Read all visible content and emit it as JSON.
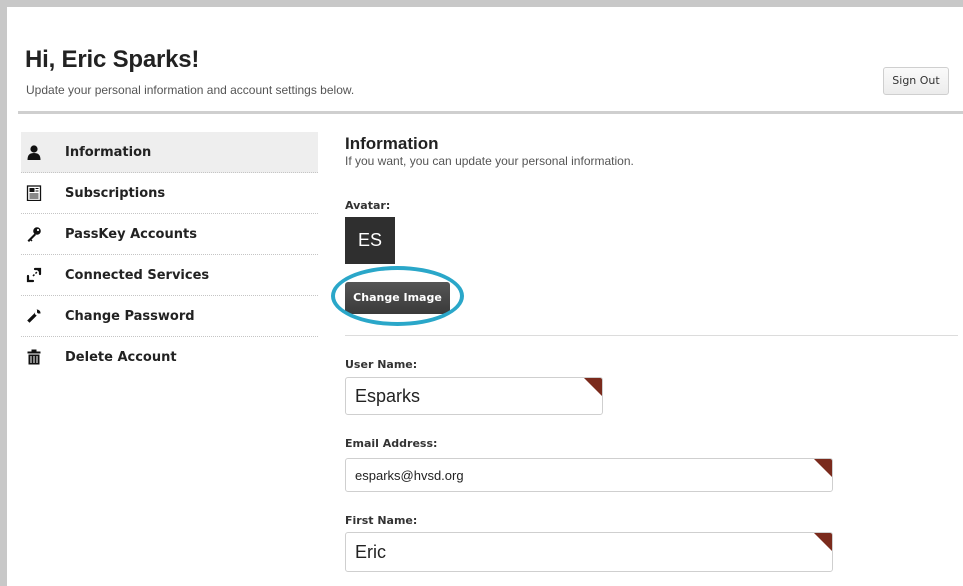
{
  "header": {
    "greeting": "Hi, Eric Sparks!",
    "subtitle": "Update your personal information and account settings below.",
    "signout_label": "Sign Out"
  },
  "sidebar": {
    "items": [
      {
        "label": "Information",
        "icon": "person-icon",
        "active": true
      },
      {
        "label": "Subscriptions",
        "icon": "newspaper-icon",
        "active": false
      },
      {
        "label": "PassKey Accounts",
        "icon": "key-icon",
        "active": false
      },
      {
        "label": "Connected Services",
        "icon": "link-icon",
        "active": false
      },
      {
        "label": "Change Password",
        "icon": "wrench-icon",
        "active": false
      },
      {
        "label": "Delete Account",
        "icon": "trash-icon",
        "active": false
      }
    ]
  },
  "main": {
    "title": "Information",
    "subtitle": "If you want, you can update your personal information.",
    "avatar_label": "Avatar:",
    "avatar_initials": "ES",
    "change_image_label": "Change Image",
    "fields": {
      "username": {
        "label": "User Name:",
        "value": "Esparks"
      },
      "email": {
        "label": "Email Address:",
        "value": "esparks@hvsd.org"
      },
      "first_name": {
        "label": "First Name:",
        "value": "Eric"
      }
    }
  },
  "colors": {
    "highlight_ring": "#2aa7c9",
    "required_marker": "#7a2a1c",
    "active_item_bg": "#eeeeee"
  }
}
